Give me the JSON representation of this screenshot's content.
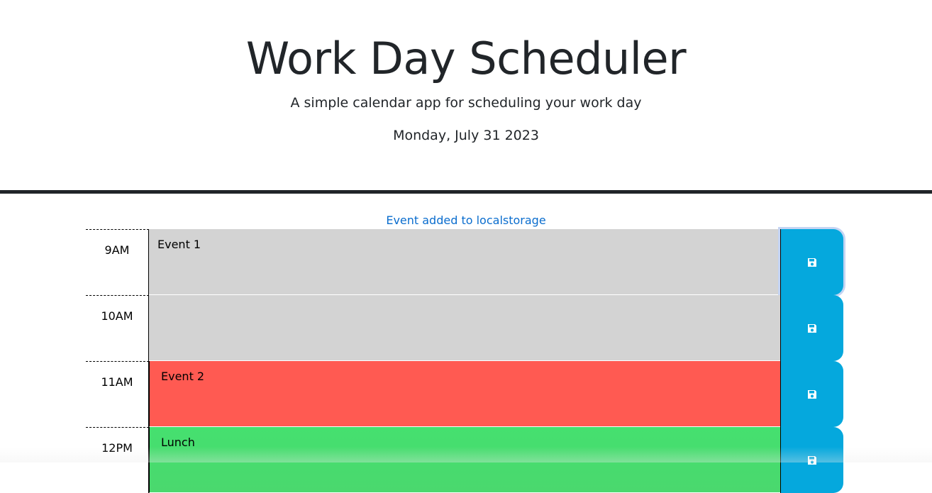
{
  "header": {
    "title": "Work Day Scheduler",
    "subtitle": "A simple calendar app for scheduling your work day",
    "current_day": "Monday, July 31 2023"
  },
  "notice": "Event added to localstorage",
  "rows": [
    {
      "hour": "9AM",
      "event": "Event 1",
      "status": "past"
    },
    {
      "hour": "10AM",
      "event": "",
      "status": "past"
    },
    {
      "hour": "11AM",
      "event": "Event 2",
      "status": "present"
    },
    {
      "hour": "12PM",
      "event": "Lunch",
      "status": "future"
    }
  ],
  "save_icon": "floppy-disk-icon",
  "colors": {
    "past": "#d3d3d3",
    "present": "#ff5a52",
    "future": "#47df6f",
    "save_button": "#05a8dd",
    "notice": "#0a6dce"
  }
}
